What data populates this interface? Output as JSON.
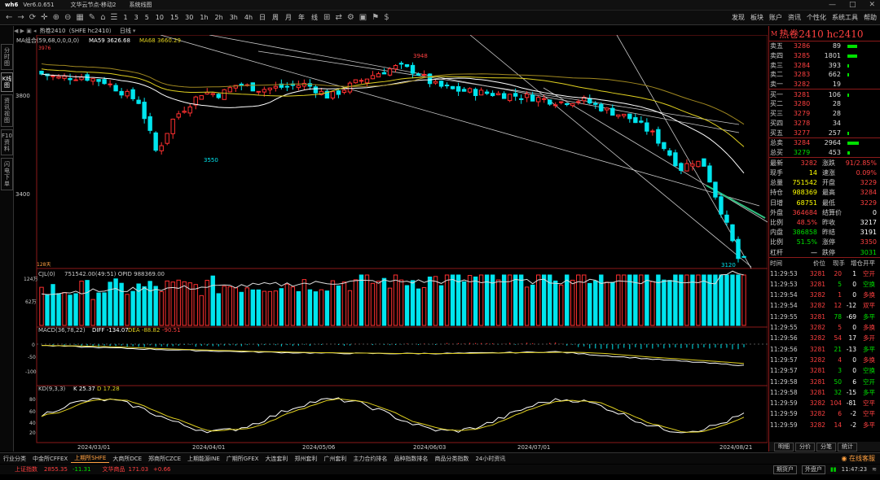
{
  "titlebar": {
    "app": "Ver6.0.651",
    "items": [
      "文华云节点-移动2",
      "系统线图"
    ],
    "controls": [
      "—",
      "□",
      "✕"
    ]
  },
  "toolbar": {
    "tools": [
      "1",
      "3",
      "5",
      "10",
      "15",
      "30",
      "1h",
      "2h",
      "3h",
      "4h",
      "日",
      "周",
      "月",
      "年",
      "线"
    ],
    "right": [
      "发现",
      "板块",
      "账户",
      "资讯",
      "个性化",
      "系统工具",
      "帮助"
    ]
  },
  "subhdr": {
    "title": "热卷2410（SHFE hc2410）",
    "period": "日线"
  },
  "sidebar": [
    "分时图",
    "K线图",
    "资讯视图",
    "F10资料",
    "闪电下单"
  ],
  "main_legend": {
    "ind": "MA组合(59,68,0,0,0,0)",
    "ma59": "MA59 3626.68",
    "ma68": "MA68 3660.29"
  },
  "price_axis": {
    "labels": [
      "3800",
      "3400"
    ],
    "high_left": "3976",
    "high_mark": "3948",
    "low_mark1": "3550",
    "low_mark2": "3120",
    "days": "128天"
  },
  "vol_legend": {
    "name": "CJL(0)",
    "text": "751542.00(49:51) OPID 988369.00",
    "ax1": "124万",
    "ax2": "62万"
  },
  "macd_legend": {
    "name": "MACD(36,78,22)",
    "diff": "DIFF -134.07",
    "dea": "DEA -88.82",
    "val": "-90.51",
    "ax": [
      "0",
      "-50",
      "-100"
    ]
  },
  "kd_legend": {
    "name": "KD(9,3,3)",
    "k": "K 25.37",
    "d": "D 17.28",
    "ax": [
      "80",
      "60",
      "40",
      "20"
    ]
  },
  "dates": [
    "2024/03/01",
    "2024/04/01",
    "2024/05/06",
    "2024/06/03",
    "2024/07/01",
    "2024/08/21"
  ],
  "quote": {
    "name": "热卷2410 hc2410",
    "asks": [
      [
        "卖五",
        "3286",
        "89",
        12
      ],
      [
        "卖四",
        "3285",
        "1801",
        12
      ],
      [
        "卖三",
        "3284",
        "393",
        2
      ],
      [
        "卖二",
        "3283",
        "662",
        2
      ],
      [
        "卖一",
        "3282",
        "19",
        0
      ]
    ],
    "bids": [
      [
        "买一",
        "3281",
        "106",
        2
      ],
      [
        "买二",
        "3280",
        "28",
        0
      ],
      [
        "买三",
        "3279",
        "28",
        0
      ],
      [
        "买四",
        "3278",
        "34",
        0
      ],
      [
        "买五",
        "3277",
        "257",
        2
      ]
    ],
    "totals": [
      [
        "总卖",
        "3284",
        "2964",
        14
      ],
      [
        "总买",
        "3279",
        "453",
        3
      ]
    ],
    "stats": [
      [
        "最新",
        "3282",
        "red",
        "涨跌",
        "91/2.85%",
        "red"
      ],
      [
        "现手",
        "14",
        "yel",
        "速涨",
        "0.09%",
        "red"
      ],
      [
        "总量",
        "751542",
        "yel",
        "开盘",
        "3229",
        "red"
      ],
      [
        "持仓",
        "988369",
        "yel",
        "最高",
        "3284",
        "red"
      ],
      [
        "日增",
        "68751",
        "yel",
        "最低",
        "3229",
        "red"
      ],
      [
        "外盘",
        "364684",
        "red",
        "结算价",
        "0",
        "wht"
      ],
      [
        "比例",
        "48.5%",
        "red",
        "昨收",
        "3217",
        "wht"
      ],
      [
        "内盘",
        "386858",
        "grn",
        "昨结",
        "3191",
        "wht"
      ],
      [
        "比例",
        "51.5%",
        "grn",
        "涨停",
        "3350",
        "red"
      ],
      [
        "杠杆",
        "—",
        "wht",
        "跌停",
        "3031",
        "grn"
      ]
    ],
    "tick_head": [
      "时间",
      "价位",
      "现手",
      "增仓",
      "开平"
    ],
    "ticks": [
      [
        "11:29:53",
        "3281",
        "20",
        "1",
        "空开",
        "red",
        "red"
      ],
      [
        "11:29:53",
        "3281",
        "5",
        "0",
        "空换",
        "grn",
        "grn"
      ],
      [
        "11:29:54",
        "3282",
        "1",
        "0",
        "多换",
        "red",
        "red"
      ],
      [
        "11:29:54",
        "3282",
        "12",
        "-12",
        "双平",
        "red",
        "red"
      ],
      [
        "11:29:55",
        "3281",
        "78",
        "-69",
        "多平",
        "grn",
        "grn"
      ],
      [
        "11:29:55",
        "3282",
        "5",
        "0",
        "多换",
        "red",
        "red"
      ],
      [
        "11:29:56",
        "3282",
        "54",
        "17",
        "多开",
        "red",
        "red"
      ],
      [
        "11:29:56",
        "3281",
        "21",
        "-13",
        "多平",
        "grn",
        "grn"
      ],
      [
        "11:29:57",
        "3282",
        "4",
        "0",
        "多换",
        "red",
        "red"
      ],
      [
        "11:29:57",
        "3281",
        "3",
        "0",
        "空换",
        "grn",
        "grn"
      ],
      [
        "11:29:58",
        "3281",
        "50",
        "6",
        "空开",
        "grn",
        "grn"
      ],
      [
        "11:29:58",
        "3281",
        "32",
        "-15",
        "多平",
        "grn",
        "grn"
      ],
      [
        "11:29:59",
        "3282",
        "104",
        "-81",
        "空平",
        "red",
        "red"
      ],
      [
        "11:29:59",
        "3282",
        "6",
        "-2",
        "空平",
        "red",
        "red"
      ],
      [
        "11:29:59",
        "3282",
        "14",
        "-2",
        "多平",
        "red",
        "red"
      ]
    ],
    "tabs": [
      "明细",
      "分价",
      "分笔",
      "统计"
    ]
  },
  "bottom_tabs": [
    "行业分类",
    "中金所CFFEX",
    "上期所SHFE",
    "大商所DCE",
    "郑商所CZCE",
    "上期能源INE",
    "广期所GFEX",
    "大连套利",
    "郑州套利",
    "广州套利",
    "主力合约排名",
    "品种指数排名",
    "商品分类指数",
    "24小时资讯"
  ],
  "bottom_active": 2,
  "status": {
    "idx1": "上证指数",
    "idx1v": "2855.35",
    "idx1c": "-11.31",
    "idx2": "文华商品",
    "idx2v": "171.03",
    "idx2c": "+0.66",
    "right": [
      "期货户",
      "外盘户"
    ],
    "time": "11:47:23",
    "live": "在线客服"
  },
  "colors": {
    "up": "#ff3030",
    "down": "#00e5ee",
    "ma59": "#ffffff",
    "ma68": "#e0d020"
  }
}
